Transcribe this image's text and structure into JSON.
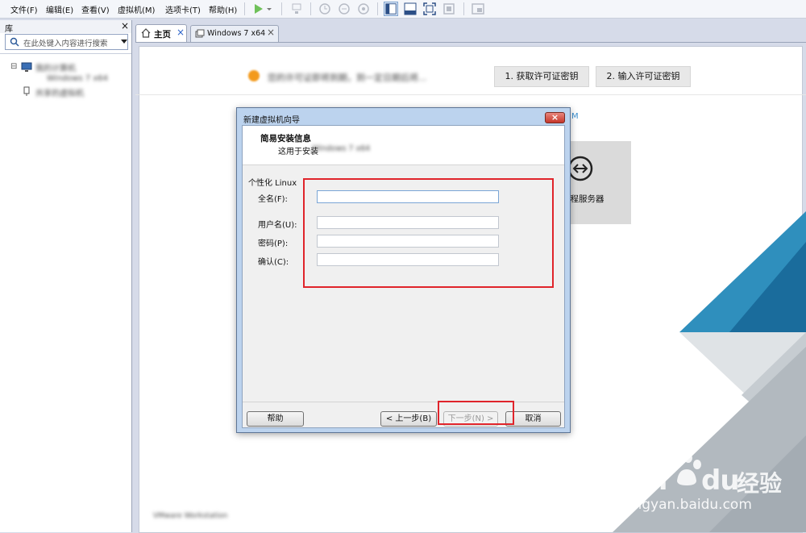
{
  "menubar": {
    "items": [
      "文件(F)",
      "编辑(E)",
      "查看(V)",
      "虚拟机(M)",
      "选项卡(T)",
      "帮助(H)"
    ],
    "toolbar_icons": [
      "play-icon",
      "dropdown-arrow-icon",
      "network-icon",
      "snapshot-icon",
      "snapshot-revert-icon",
      "snapshot-manager-icon",
      "library-view-icon",
      "thumbnail-bar-icon",
      "fullscreen-icon",
      "unity-icon",
      "console-view-icon"
    ]
  },
  "library": {
    "title": "库",
    "close": "×",
    "search_placeholder": "在此处键入内容进行搜索",
    "tree": [
      {
        "label": "我的计算机",
        "expander": "⊟"
      },
      {
        "label": "Windows 7 x64"
      },
      {
        "label": "共享的虚拟机"
      }
    ]
  },
  "tabs": [
    {
      "label": "主页",
      "close": "×"
    },
    {
      "label": "Windows 7 x64",
      "close": "×"
    }
  ],
  "home": {
    "notice": "您的许可证即将到期，到一定日期后将...",
    "btn1": "1. 获取许可证密钥",
    "btn2": "2. 输入许可证密钥",
    "m_text": "M",
    "remote_tile_label": "远程服务器",
    "footer_text": "VMware Workstation"
  },
  "dialog": {
    "title": "新建虚拟机向导",
    "close": "×",
    "header_title": "简易安装信息",
    "header_subtitle": "这用于安装",
    "header_subtitle_blur": "Windows 7 x64",
    "group_label": "个性化 Linux",
    "fields": {
      "fullname_label": "全名(F):",
      "username_label": "用户名(U):",
      "password_label": "密码(P):",
      "confirm_label": "确认(C):",
      "fullname_value": "",
      "username_value": "",
      "password_value": "",
      "confirm_value": ""
    },
    "buttons": {
      "help": "帮助",
      "back": "< 上一步(B)",
      "next": "下一步(N) >",
      "cancel": "取消"
    }
  },
  "watermark": {
    "brand": "Bai",
    "brand2": "du",
    "cn": "经验",
    "url": "jingyan.baidu.com"
  },
  "colors": {
    "accent_red": "#e0242b",
    "orange_dot": "#f39a1c",
    "deco_blue": "#1a6c9c"
  }
}
